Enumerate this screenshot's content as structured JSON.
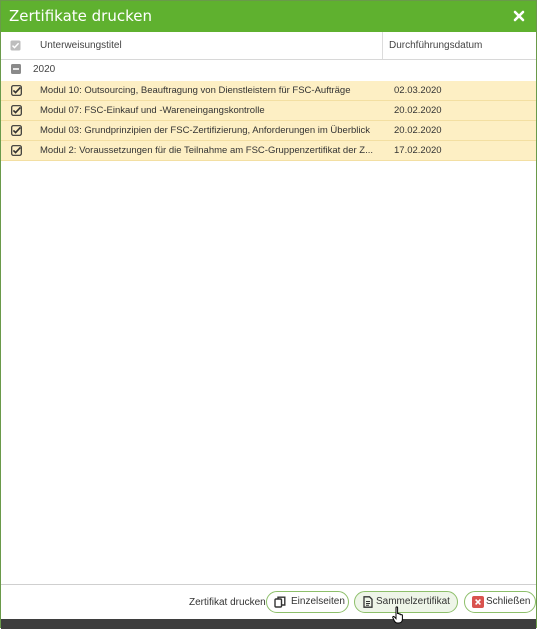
{
  "dialog": {
    "title": "Zertifikate drucken"
  },
  "columns": {
    "title": "Unterweisungstitel",
    "date": "Durchführungsdatum"
  },
  "group": {
    "label": "2020",
    "expanded": true
  },
  "rows": [
    {
      "title": "Modul 10: Outsourcing, Beauftragung von Dienstleistern für FSC-Aufträge",
      "date": "02.03.2020",
      "checked": true
    },
    {
      "title": "Modul 07: FSC-Einkauf und -Wareneingangskontrolle",
      "date": "20.02.2020",
      "checked": true
    },
    {
      "title": "Modul 03: Grundprinzipien der FSC-Zertifizierung, Anforderungen im Überblick",
      "date": "20.02.2020",
      "checked": true
    },
    {
      "title": "Modul 2: Voraussetzungen für die Teilnahme am FSC-Gruppenzertifikat der Z...",
      "date": "17.02.2020",
      "checked": true
    }
  ],
  "footer": {
    "label": "Zertifikat drucken",
    "einzelseiten": "Einzelseiten",
    "sammelzertifikat": "Sammelzertifikat",
    "schliessen": "Schließen"
  },
  "colors": {
    "title_bar": "#5fb12f",
    "selected_row": "#fdefc4",
    "close_icon_bg": "#d9534f"
  }
}
